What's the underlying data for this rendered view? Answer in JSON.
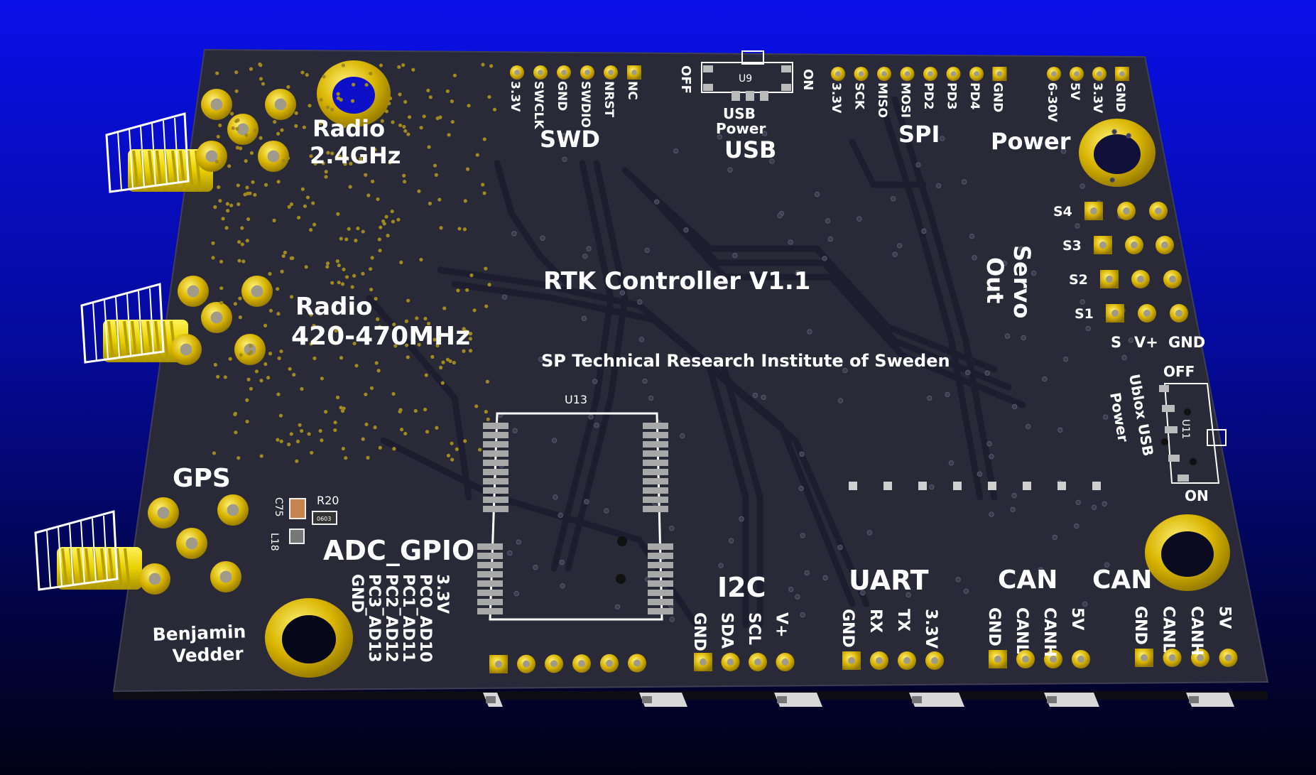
{
  "board": {
    "title": "RTK Controller V1.1",
    "org": "SP Technical Research Institute of Sweden",
    "author_line1": "Benjamin",
    "author_line2": "Vedder"
  },
  "antennas": {
    "radio24_line1": "Radio",
    "radio24_line2": "2.4GHz",
    "radio4_line1": "Radio",
    "radio4_line2": "420-470MHz",
    "gps": "GPS"
  },
  "swd": {
    "title": "SWD",
    "pins": [
      "3.3V",
      "SWCLK",
      "GND",
      "SWDIO",
      "NRST",
      "NC"
    ]
  },
  "usb": {
    "title": "USB",
    "sub1": "USB",
    "sub2": "Power",
    "off": "OFF",
    "on": "ON",
    "ref": "U9"
  },
  "spi": {
    "title": "SPI",
    "pins": [
      "3.3V",
      "SCK",
      "MISO",
      "MOSI",
      "PD2",
      "PD3",
      "PD4",
      "GND"
    ]
  },
  "power": {
    "title": "Power",
    "pins": [
      "6-30V",
      "5V",
      "3.3V",
      "GND"
    ]
  },
  "servo": {
    "title_line1": "Servo",
    "title_line2": "Out",
    "rows": [
      "S4",
      "S3",
      "S2",
      "S1"
    ],
    "cols": [
      "S",
      "V+",
      "GND"
    ]
  },
  "ublox": {
    "line1": "Ublox USB",
    "line2": "Power",
    "off": "OFF",
    "on": "ON",
    "ref": "U11"
  },
  "module": {
    "ref": "U13"
  },
  "components": {
    "c75": "C75",
    "r20": "R20",
    "l18": "L18",
    "pkg": "0603"
  },
  "adc": {
    "title": "ADC_GPIO",
    "pins": [
      "GND",
      "PC3_AD13",
      "PC2_AD12",
      "PC1_AD11",
      "PC0_AD10",
      "3.3V"
    ]
  },
  "i2c": {
    "title": "I2C",
    "pins": [
      "GND",
      "SDA",
      "SCL",
      "V+"
    ]
  },
  "uart": {
    "title": "UART",
    "pins": [
      "GND",
      "RX",
      "TX",
      "3.3V"
    ]
  },
  "can1": {
    "title": "CAN",
    "pins": [
      "GND",
      "CANL",
      "CANH",
      "5V"
    ]
  },
  "can2": {
    "title": "CAN",
    "pins": [
      "GND",
      "CANL",
      "CANH",
      "5V"
    ]
  },
  "colors": {
    "board": "#2a2938",
    "board_edge": "#16151f",
    "trace": "#22213a",
    "gold": "#c9a800",
    "gold_light": "#ffe94a",
    "silk": "#ffffff"
  }
}
